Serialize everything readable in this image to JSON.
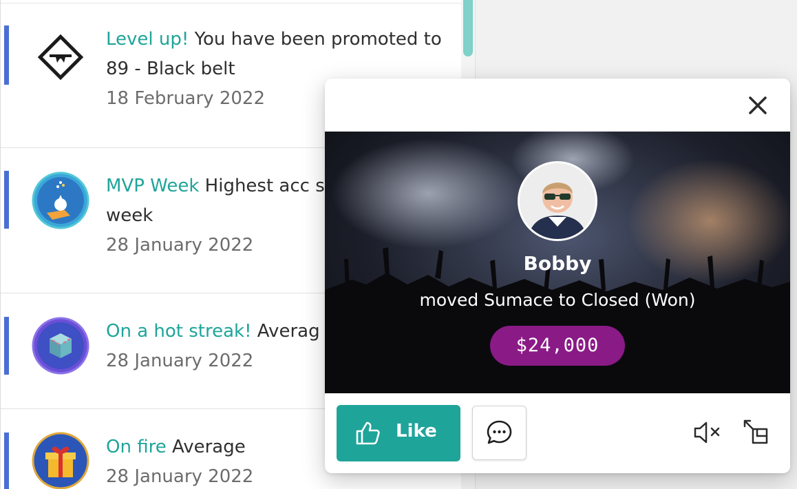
{
  "feed": {
    "items": [
      {
        "highlight": "Level up!",
        "text": " You have been promoted to 89 - Black belt",
        "date": "18 February 2022",
        "icon": "black-belt-diamond-icon"
      },
      {
        "highlight": "MVP Week",
        "text": " Highest acc sales this week",
        "date": "28 January 2022",
        "icon": "mvp-trophy-icon"
      },
      {
        "highlight": "On a hot streak!",
        "text": " Averag",
        "date": "28 January 2022",
        "icon": "hot-streak-cube-icon"
      },
      {
        "highlight": "On fire",
        "text": " Average",
        "date": "28 January 2022",
        "icon": "gift-box-icon"
      }
    ]
  },
  "popup": {
    "name": "Bobby",
    "action": "moved Sumace to Closed (Won)",
    "amount": "$24,000",
    "like_label": "Like",
    "amount_color": "#8a1a86",
    "accent_color": "#1fa49a"
  },
  "colors": {
    "feed_accent": "#4a6fd4",
    "highlight": "#1fa49a",
    "scroll_thumb": "#7fd1c9"
  }
}
